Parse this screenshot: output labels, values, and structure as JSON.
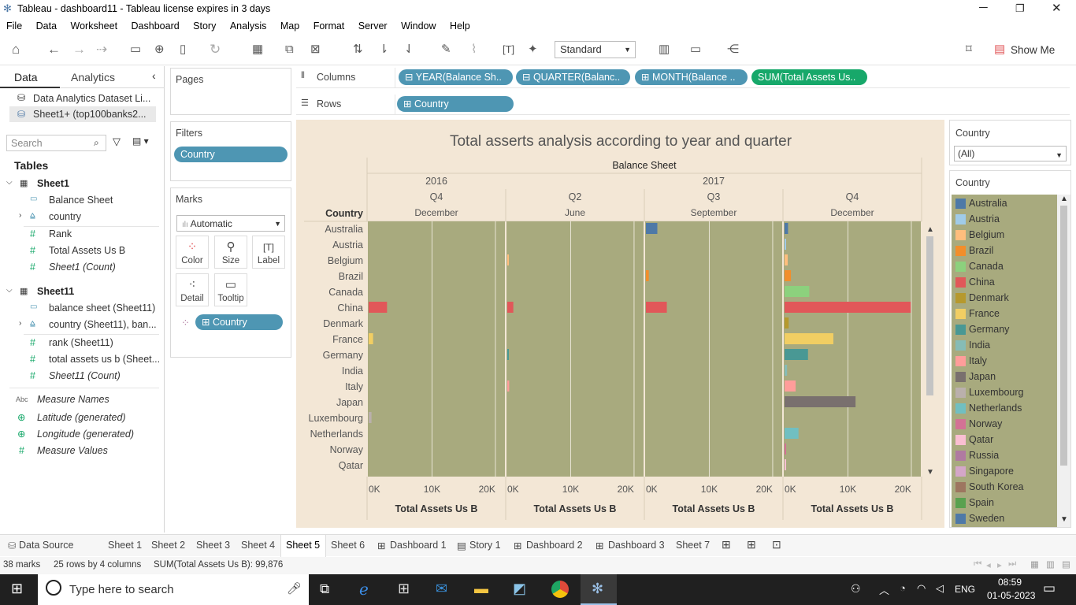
{
  "window": {
    "title": "Tableau - dashboard11 - Tableau license expires in 3 days"
  },
  "menu": [
    "File",
    "Data",
    "Worksheet",
    "Dashboard",
    "Story",
    "Analysis",
    "Map",
    "Format",
    "Server",
    "Window",
    "Help"
  ],
  "toolbar": {
    "fit": "Standard",
    "show_me": "Show Me"
  },
  "data_pane": {
    "tab_data": "Data",
    "tab_analytics": "Analytics",
    "sources": [
      "Data Analytics Dataset Li...",
      "Sheet1+ (top100banks2..."
    ],
    "search_placeholder": "Search",
    "tables_heading": "Tables",
    "sheet1": {
      "name": "Sheet1",
      "fields": [
        "Balance Sheet",
        "country",
        "Rank",
        "Total Assets Us B",
        "Sheet1 (Count)"
      ]
    },
    "sheet11": {
      "name": "Sheet11",
      "fields": [
        "balance sheet (Sheet11)",
        "country (Sheet11), ban...",
        "rank (Sheet11)",
        "total assets us b (Sheet...",
        "Sheet11 (Count)"
      ]
    },
    "extras": [
      "Measure Names",
      "Latitude (generated)",
      "Longitude (generated)",
      "Measure Values"
    ],
    "abc_icon": "Abc"
  },
  "pages": {
    "label": "Pages"
  },
  "filters": {
    "label": "Filters",
    "pill": "Country"
  },
  "marks": {
    "label": "Marks",
    "type": "Automatic",
    "buttons": [
      "Color",
      "Size",
      "Label",
      "Detail",
      "Tooltip"
    ],
    "pill": "Country"
  },
  "shelves": {
    "columns_label": "Columns",
    "rows_label": "Rows",
    "columns": [
      "YEAR(Balance Sh..",
      "QUARTER(Balanc..",
      "MONTH(Balance ..",
      "SUM(Total Assets Us.."
    ],
    "rows": [
      "Country"
    ]
  },
  "viz": {
    "title": "Total asserts analysis according to year and quarter",
    "header_top": "Balance Sheet",
    "years": [
      "2016",
      "2017"
    ],
    "quarters": [
      "Q4",
      "Q2",
      "Q3",
      "Q4"
    ],
    "months": [
      "December",
      "June",
      "September",
      "December"
    ],
    "row_header": "Country",
    "axis_ticks": [
      "0K",
      "10K",
      "20K"
    ],
    "axis_title": "Total Assets Us B"
  },
  "chart_data": {
    "type": "bar",
    "title": "Total asserts analysis according to year and quarter",
    "categories": [
      "Australia",
      "Austria",
      "Belgium",
      "Brazil",
      "Canada",
      "China",
      "Denmark",
      "France",
      "Germany",
      "India",
      "Italy",
      "Japan",
      "Luxembourg",
      "Netherlands",
      "Norway",
      "Qatar"
    ],
    "panels": [
      "2016 Q4 December",
      "2017 Q2 June",
      "2017 Q3 September",
      "2017 Q4 December"
    ],
    "xlim": [
      0,
      21000
    ],
    "xlabel": "Total Assets Us B",
    "series": [
      {
        "name": "2016 Q4 December",
        "values": [
          0,
          0,
          0,
          0,
          0,
          2900,
          0,
          700,
          0,
          0,
          0,
          0,
          450,
          0,
          0,
          0
        ]
      },
      {
        "name": "2017 Q2 June",
        "values": [
          0,
          0,
          150,
          0,
          0,
          950,
          0,
          0,
          150,
          0,
          300,
          0,
          0,
          0,
          0,
          0
        ]
      },
      {
        "name": "2017 Q3 September",
        "values": [
          1800,
          0,
          0,
          450,
          0,
          3300,
          0,
          0,
          0,
          0,
          0,
          0,
          0,
          0,
          0,
          0
        ]
      },
      {
        "name": "2017 Q4 December",
        "values": [
          550,
          150,
          500,
          1000,
          3900,
          19900,
          650,
          7700,
          3700,
          400,
          1750,
          11200,
          0,
          2200,
          150,
          100
        ]
      }
    ]
  },
  "country_filter": {
    "title": "Country",
    "value": "(All)"
  },
  "legend": {
    "title": "Country",
    "items": [
      {
        "name": "Australia",
        "color": "#4e79a7"
      },
      {
        "name": "Austria",
        "color": "#a0cbe8"
      },
      {
        "name": "Belgium",
        "color": "#ffbe7d"
      },
      {
        "name": "Brazil",
        "color": "#f28e2b"
      },
      {
        "name": "Canada",
        "color": "#8cd17d"
      },
      {
        "name": "China",
        "color": "#e15759"
      },
      {
        "name": "Denmark",
        "color": "#b6992d"
      },
      {
        "name": "France",
        "color": "#f1ce63"
      },
      {
        "name": "Germany",
        "color": "#499894"
      },
      {
        "name": "India",
        "color": "#86bcb6"
      },
      {
        "name": "Italy",
        "color": "#ff9d9a"
      },
      {
        "name": "Japan",
        "color": "#79706e"
      },
      {
        "name": "Luxembourg",
        "color": "#bab0ac"
      },
      {
        "name": "Netherlands",
        "color": "#71bfc1"
      },
      {
        "name": "Norway",
        "color": "#d37295"
      },
      {
        "name": "Qatar",
        "color": "#fabfd2"
      },
      {
        "name": "Russia",
        "color": "#b07aa1"
      },
      {
        "name": "Singapore",
        "color": "#d4a6c8"
      },
      {
        "name": "South Korea",
        "color": "#9d7660"
      },
      {
        "name": "Spain",
        "color": "#59a14f"
      },
      {
        "name": "Sweden",
        "color": "#4e79a7"
      }
    ]
  },
  "sheet_tabs": [
    "Data Source",
    "Sheet 1",
    "Sheet 2",
    "Sheet 3",
    "Sheet 4",
    "Sheet 5",
    "Sheet 6",
    "Dashboard 1",
    "Story 1",
    "Dashboard 2",
    "Dashboard 3",
    "Sheet 7"
  ],
  "active_tab": "Sheet 5",
  "status": {
    "marks": "38 marks",
    "rows_cols": "25 rows by 4 columns",
    "sum": "SUM(Total Assets Us B): 99,876"
  },
  "taskbar": {
    "search_placeholder": "Type here to search",
    "lang": "ENG",
    "time": "08:59",
    "date": "01-05-2023"
  }
}
